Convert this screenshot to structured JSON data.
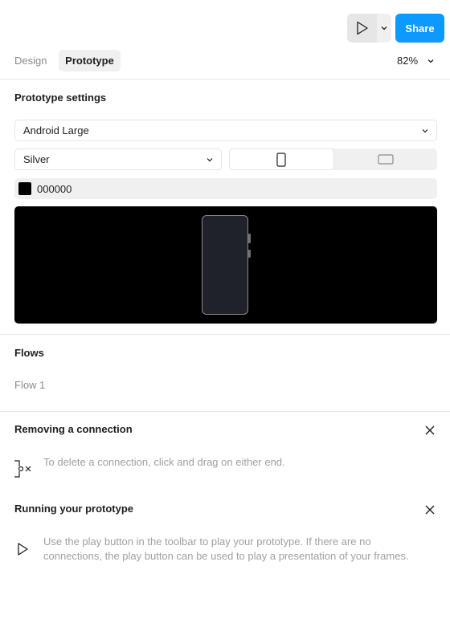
{
  "toolbar": {
    "play_icon": "play-icon",
    "dropdown_icon": "chevron-down-icon",
    "share_label": "Share"
  },
  "tabs": {
    "design_label": "Design",
    "prototype_label": "Prototype",
    "zoom_value": "82%"
  },
  "prototype_settings": {
    "title": "Prototype settings",
    "device": "Android Large",
    "model_color": "Silver",
    "orientation": "portrait",
    "background_hex": "000000",
    "background_color": "#000000"
  },
  "flows": {
    "title": "Flows",
    "items": [
      "Flow 1"
    ]
  },
  "tips": [
    {
      "title": "Removing a connection",
      "text": "To delete a connection, click and drag on either end.",
      "icon": "disconnect-icon"
    },
    {
      "title": "Running your prototype",
      "text": "Use the play button in the toolbar to play your prototype. If there are no connections, the play button can be used to play a presentation of your frames.",
      "icon": "play-icon"
    }
  ],
  "colors": {
    "accent": "#0d99ff",
    "muted_text": "#a0a0a0",
    "divider": "#e6e6e6",
    "device_body": "#1f222a"
  }
}
